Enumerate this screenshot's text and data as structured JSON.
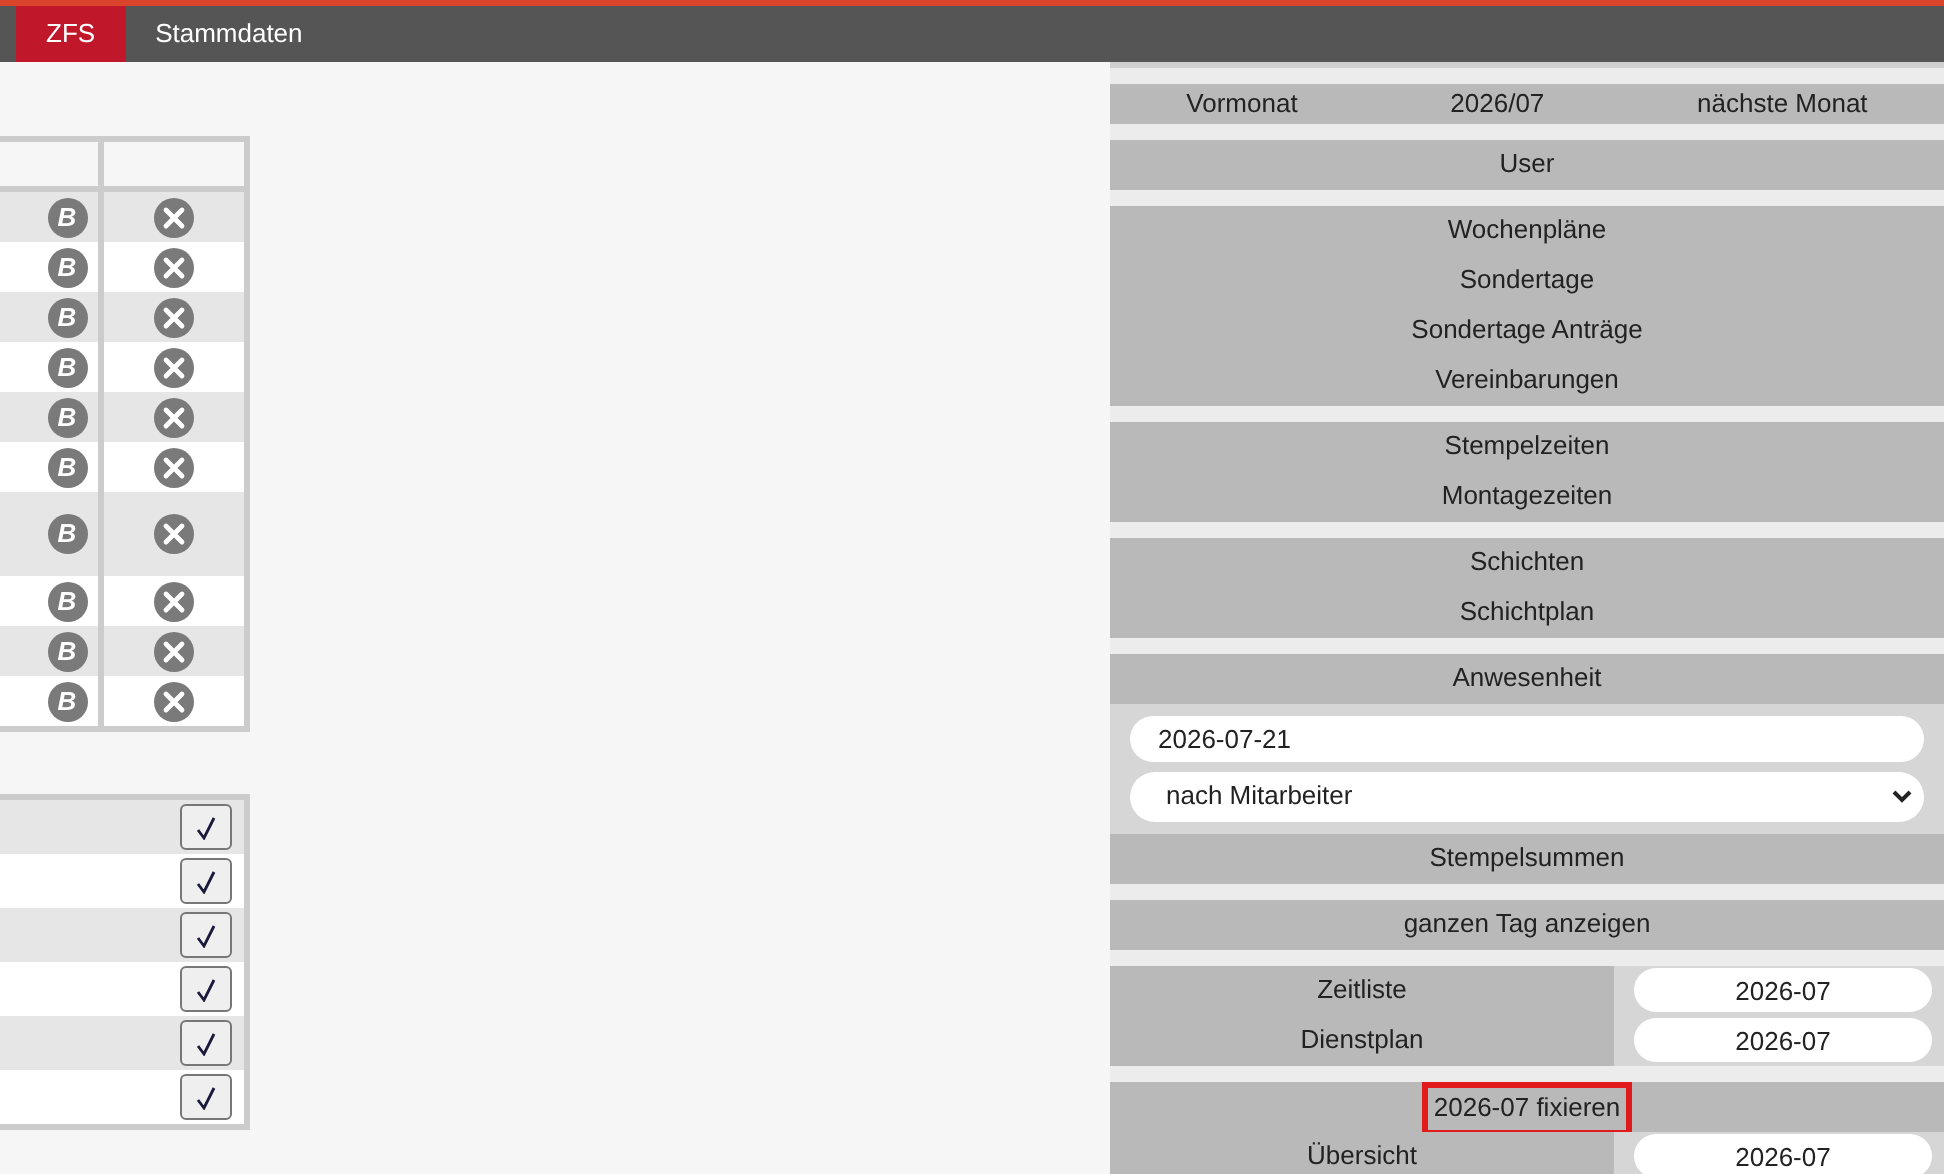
{
  "nav": {
    "tabs": [
      {
        "label": "ZFS",
        "selected": true
      },
      {
        "label": "Stammdaten",
        "selected": false
      }
    ]
  },
  "icon_table": {
    "rows": [
      {
        "badge": "B",
        "tall": false
      },
      {
        "badge": "B",
        "tall": false
      },
      {
        "badge": "B",
        "tall": false
      },
      {
        "badge": "B",
        "tall": false
      },
      {
        "badge": "B",
        "tall": false
      },
      {
        "badge": "B",
        "tall": false
      },
      {
        "badge": "B",
        "tall": true
      },
      {
        "badge": "B",
        "tall": false
      },
      {
        "badge": "B",
        "tall": false
      },
      {
        "badge": "B",
        "tall": false
      }
    ]
  },
  "check_table": {
    "rows": [
      {
        "checked": true
      },
      {
        "checked": true
      },
      {
        "checked": true
      },
      {
        "checked": true
      },
      {
        "checked": true
      },
      {
        "checked": true
      }
    ]
  },
  "side_panel": {
    "sections": [
      {
        "kind": "month_nav",
        "items": [
          "Vormonat",
          "2026/07",
          "nächste Monat"
        ]
      },
      {
        "kind": "links",
        "items": [
          "User"
        ]
      },
      {
        "kind": "links",
        "items": [
          "Wochenpläne",
          "Sondertage",
          "Sondertage Anträge",
          "Vereinbarungen"
        ]
      },
      {
        "kind": "links",
        "items": [
          "Stempelzeiten",
          "Montagezeiten"
        ]
      },
      {
        "kind": "links",
        "items": [
          "Schichten",
          "Schichtplan"
        ]
      },
      {
        "kind": "form",
        "title": "Anwesenheit",
        "date_value": "2026-07-21",
        "select_value": "nach Mitarbeiter",
        "button": "Stempelsummen"
      },
      {
        "kind": "links",
        "items": [
          "ganzen Tag anzeigen"
        ]
      },
      {
        "kind": "link_fields",
        "rows": [
          {
            "label": "Zeitliste",
            "value": "2026-07"
          },
          {
            "label": "Dienstplan",
            "value": "2026-07"
          }
        ]
      },
      {
        "kind": "fix",
        "title": "2026-07 fixieren",
        "highlighted": true,
        "rows": [
          {
            "label": "Übersicht",
            "value": "2026-07"
          }
        ]
      }
    ]
  }
}
